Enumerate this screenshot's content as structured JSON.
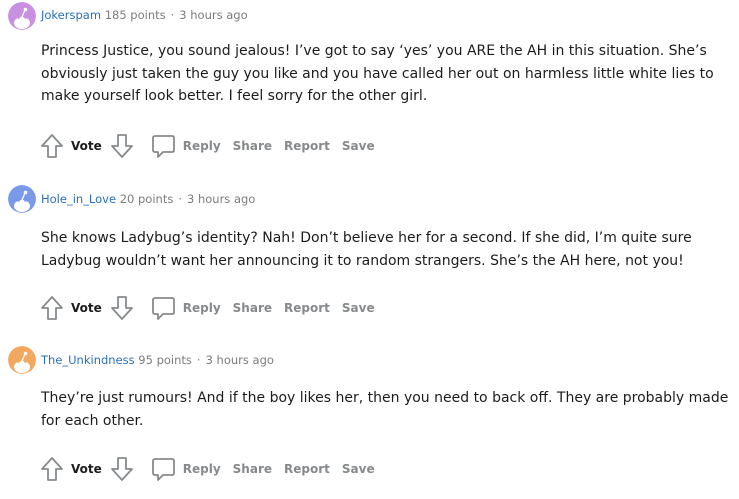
{
  "comments": [
    {
      "username": "Jokerspam",
      "points": "185 points",
      "time": "3 hours ago",
      "avatar_color": "#c98fe0",
      "text": "Princess Justice, you sound jealous! I’ve got to say ‘yes’ you ARE the AH in this situation. She’s obviously just taken the guy you like and you have called her out on harmless little white lies to make yourself look better. I feel sorry for the other girl.",
      "actions": {
        "vote": "Vote",
        "reply": "Reply",
        "share": "Share",
        "report": "Report",
        "save": "Save"
      }
    },
    {
      "username": "Hole_in_Love",
      "points": "20 points",
      "time": "3 hours ago",
      "avatar_color": "#7a99e8",
      "text": "She knows Ladybug’s identity? Nah! Don’t believe her for a second. If she did, I’m quite sure Ladybug wouldn’t want her announcing it to random strangers. She’s the AH here, not you!",
      "actions": {
        "vote": "Vote",
        "reply": "Reply",
        "share": "Share",
        "report": "Report",
        "save": "Save"
      }
    },
    {
      "username": "The_Unkindness",
      "points": "95 points",
      "time": "3 hours ago",
      "avatar_color": "#f3a85f",
      "text": "They’re just rumours! And if the boy likes her, then you need to back off. They are probably made for each other.",
      "actions": {
        "vote": "Vote",
        "reply": "Reply",
        "share": "Share",
        "report": "Report",
        "save": "Save"
      }
    }
  ],
  "colors": {
    "username": "#2a6fb8",
    "meta_text": "#7c7c7c",
    "action_text": "#878a8c",
    "body_text": "#1c1c1c"
  },
  "icons": [
    "avatar-snoo",
    "upvote-arrow",
    "downvote-arrow",
    "comment-bubble"
  ]
}
